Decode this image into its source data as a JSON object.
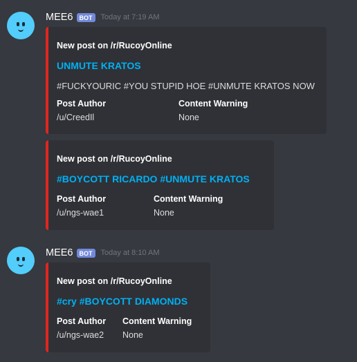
{
  "messages": [
    {
      "username": "MEE6",
      "bot_tag": "BOT",
      "timestamp": "Today at 7:19 AM",
      "embeds": [
        {
          "author": "New post on /r/RucoyOnline",
          "title": "UNMUTE KRATOS",
          "description": "#FUCKYOURIC #YOU STUPID HOE #UNMUTE KRATOS NOW",
          "fields": [
            {
              "name": "Post Author",
              "value": "/u/CreedIl"
            },
            {
              "name": "Content Warning",
              "value": "None"
            }
          ]
        },
        {
          "author": "New post on /r/RucoyOnline",
          "title": "#BOYCOTT RICARDO #UNMUTE KRATOS",
          "fields": [
            {
              "name": "Post Author",
              "value": "/u/ngs-wae1"
            },
            {
              "name": "Content Warning",
              "value": "None"
            }
          ]
        }
      ]
    },
    {
      "username": "MEE6",
      "bot_tag": "BOT",
      "timestamp": "Today at 8:10 AM",
      "embeds": [
        {
          "author": "New post on /r/RucoyOnline",
          "title": "#cry #BOYCOTT DIAMONDS",
          "fields": [
            {
              "name": "Post Author",
              "value": "/u/ngs-wae2"
            },
            {
              "name": "Content Warning",
              "value": "None"
            }
          ]
        }
      ]
    }
  ],
  "colors": {
    "background": "#36393f",
    "embed_background": "#2f3136",
    "embed_border": "#e0261f",
    "link": "#00b0f4",
    "bot_tag": "#7289da",
    "avatar": "#52cdfc"
  },
  "icons": {
    "avatar": "mee6-avatar-icon"
  }
}
